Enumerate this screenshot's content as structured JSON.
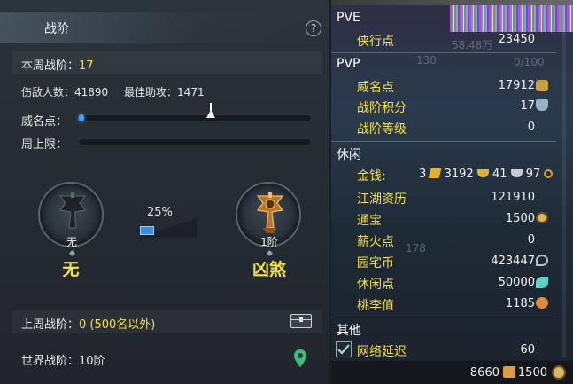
{
  "left_panel": {
    "title": "战阶",
    "help_label": "?",
    "week_rank_label": "本周战阶：",
    "week_rank_value": "17",
    "defeated_label": "伤敌人数：",
    "defeated_value": "41890",
    "best_assist_label": "最佳助攻：",
    "best_assist_value": "1471",
    "prestige_label": "威名点：",
    "weekly_cap_label": "周上限：",
    "current_rank": {
      "sub": "无",
      "name": "无"
    },
    "next_rank": {
      "sub": "1阶",
      "name": "凶煞"
    },
    "progress_text": "25%",
    "progress_fraction": 0.25,
    "last_week_label": "上周战阶：",
    "last_week_value": "0 (500名以外)",
    "world_rank_label": "世界战阶：",
    "world_rank_value": "10阶"
  },
  "right_panel": {
    "ghost": {
      "a": "58.48万",
      "b": "130",
      "c": "0/100",
      "d": "178"
    },
    "pve": {
      "title": "PVE",
      "items": [
        {
          "label": "侠行点",
          "value": "23450"
        }
      ]
    },
    "pvp": {
      "title": "PVP",
      "items": [
        {
          "label": "威名点",
          "value": "17912"
        },
        {
          "label": "战阶积分",
          "value": "17"
        },
        {
          "label": "战阶等级",
          "value": "0"
        }
      ]
    },
    "leisure": {
      "title": "休闲",
      "money_label": "金钱:",
      "money": {
        "gold_bars": "3",
        "gold": "3192",
        "silver": "41",
        "copper": "97"
      },
      "items": [
        {
          "label": "江湖资历",
          "value": "121910"
        },
        {
          "label": "通宝",
          "value": "1500"
        },
        {
          "label": "薪火点",
          "value": "0"
        },
        {
          "label": "园宅币",
          "value": "423447"
        },
        {
          "label": "休闲点",
          "value": "50000"
        },
        {
          "label": "桃李值",
          "value": "1185"
        }
      ]
    },
    "other": {
      "title": "其他",
      "network_label": "网络延迟",
      "network_value": "60",
      "network_checked": true
    },
    "bottom_bar": {
      "left_value": "8660",
      "right_value": "1500"
    }
  },
  "colors": {
    "accent_yellow": "#f4e04a",
    "progress_blue": "#3aa0ff"
  }
}
